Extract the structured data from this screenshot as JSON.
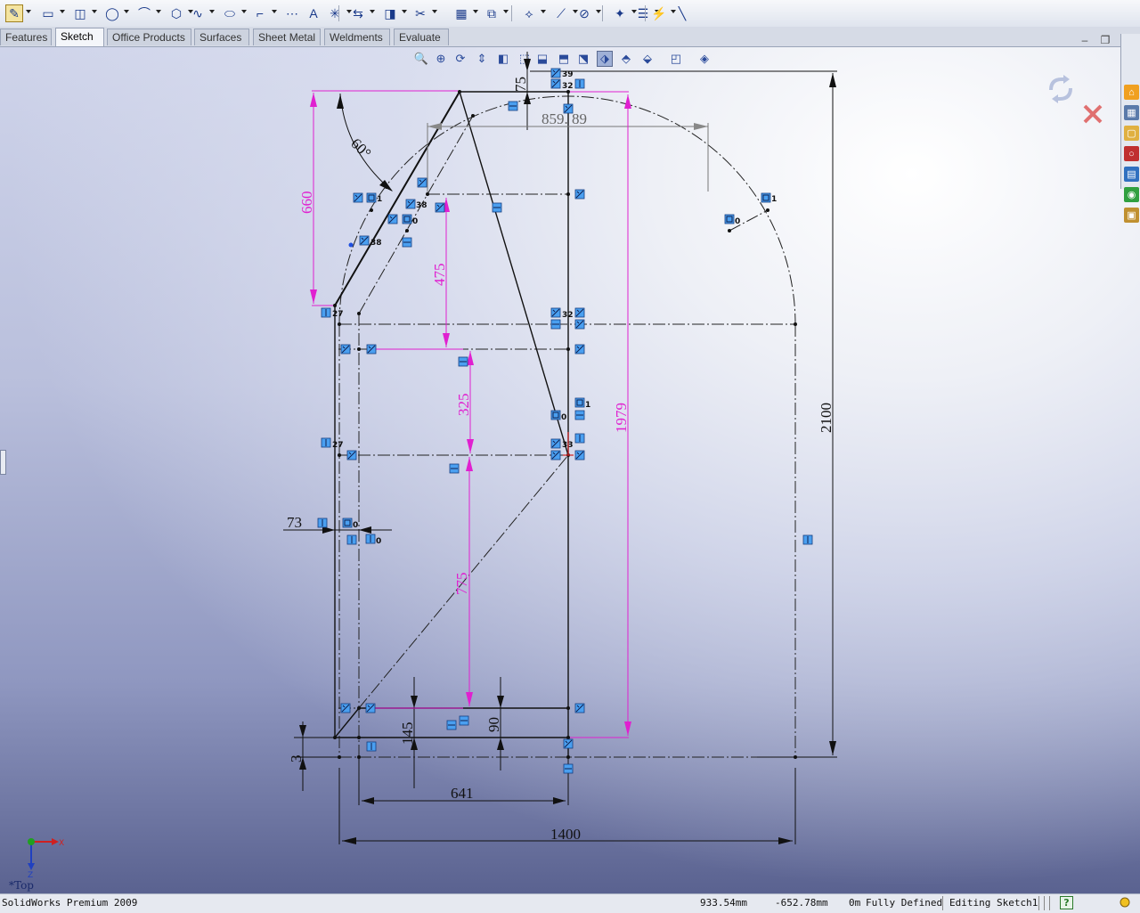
{
  "tabs": [
    {
      "label": "Features",
      "active": false
    },
    {
      "label": "Sketch",
      "active": true
    },
    {
      "label": "Office Products",
      "active": false
    },
    {
      "label": "Surfaces",
      "active": false
    },
    {
      "label": "Sheet Metal",
      "active": false
    },
    {
      "label": "Weldments",
      "active": false
    },
    {
      "label": "Evaluate",
      "active": false
    }
  ],
  "toolbar": {
    "icons": [
      "sketch-icon",
      "rectangle-icon",
      "slot-icon",
      "circle-icon",
      "arc-icon",
      "polygon-icon",
      "spline-icon",
      "ellipse-icon",
      "fillet-icon",
      "construction-icon",
      "text-icon",
      "point-icon",
      "mirror-icon",
      "offset-icon",
      "trim-icon",
      "pattern-icon",
      "convert-icon",
      "smart-dimension-icon",
      "add-relation-icon",
      "display-relations-icon",
      "repair-sketch-icon",
      "quick-snaps-icon",
      "rapid-sketch-icon",
      "line-icon",
      "centerline-icon"
    ]
  },
  "view_toolbar": {
    "icons": [
      "zoom-to-fit-icon",
      "zoom-area-icon",
      "rotate-icon",
      "pan-icon",
      "section-view-icon",
      "normal-to-icon",
      "front-view-icon",
      "top-view-icon",
      "right-view-icon",
      "isometric-view-icon",
      "trimetric-view-icon",
      "view-orientation-icon",
      "display-style-icon",
      "hide-show-icon"
    ]
  },
  "sketch": {
    "dimensions": {
      "angle": "60°",
      "d_660": "660",
      "d_75": "75",
      "d_859": "859. 89",
      "d_475": "475",
      "d_325": "325",
      "d_1979": "1979",
      "d_2100": "2100",
      "d_73": "73",
      "d_775": "775",
      "d_145": "145",
      "d_90": "90",
      "d_3": "3",
      "d_641": "641",
      "d_1400": "1400"
    },
    "relation_numbers": [
      "39",
      "32",
      "1",
      "38",
      "0",
      "38",
      "27",
      "32",
      "1",
      "0",
      "33",
      "27",
      "0",
      "0",
      "1",
      "0"
    ]
  },
  "triad": {
    "x": "X",
    "z": "Z"
  },
  "view_label": "*Top",
  "status": {
    "product": "SolidWorks Premium 2009",
    "x_coord": "933.54mm",
    "y_coord": "-652.78mm",
    "z_coord": "0m",
    "definition": "Fully Defined",
    "mode": "Editing Sketch1",
    "help": "?"
  },
  "colors": {
    "dimension": "#e020d0",
    "relation": "#4a9ff0",
    "geometry": "#111111"
  }
}
